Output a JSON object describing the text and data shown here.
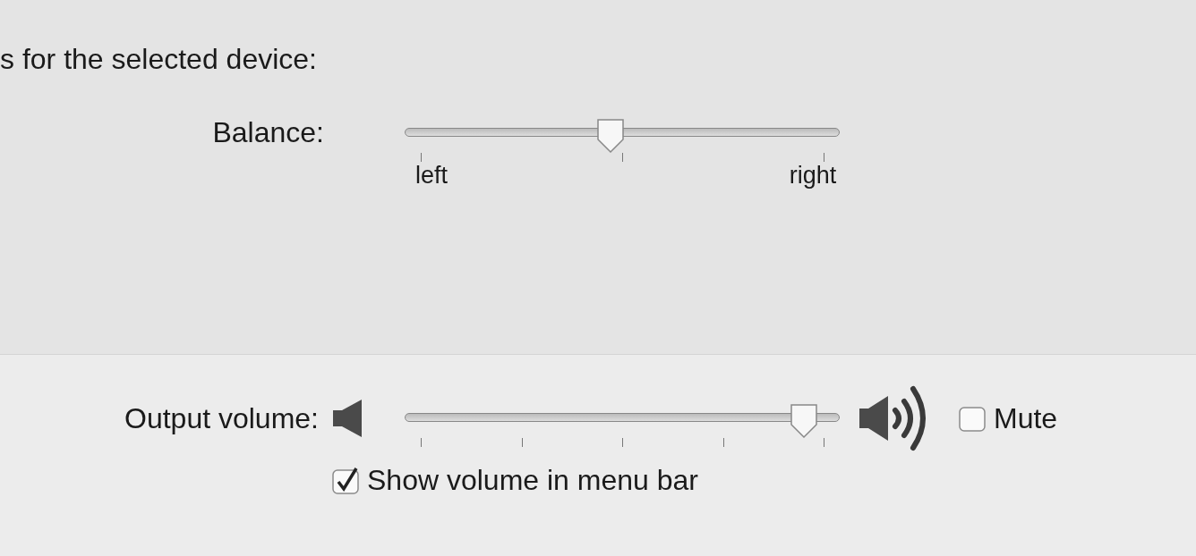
{
  "intro": "s for the selected device:",
  "balance": {
    "label": "Balance:",
    "level": 0.47,
    "tick_labels": [
      "left",
      "right"
    ]
  },
  "output_volume": {
    "label": "Output volume:",
    "level": 0.95
  },
  "mute": {
    "label": "Mute",
    "checked": false
  },
  "show_in_menu_bar": {
    "label": "Show volume in menu bar",
    "checked": true
  }
}
